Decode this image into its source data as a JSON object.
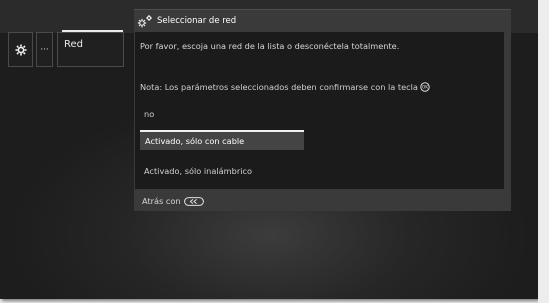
{
  "side_menu": {
    "gear_icon": "gear-icon",
    "more_label": "···",
    "red_label": "Red"
  },
  "dialog": {
    "title_icon": "network-settings-icon",
    "title": "Seleccionar de red",
    "instruction": "Por favor, escoja una red de la lista o desconéctela totalmente.",
    "note": "Nota: Los parámetros seleccionados deben confirmarse con la tecla",
    "note_button_icon": "ok-button-icon",
    "options": [
      {
        "label": "no",
        "selected": false
      },
      {
        "label": "Activado, sólo con cable",
        "selected": true
      },
      {
        "label": "Activado, sólo inalámbrico",
        "selected": false
      }
    ],
    "back_label": "Atrás con",
    "back_button_icon": "back-button-icon"
  },
  "colors": {
    "background": "#1d1d1d",
    "dialog": "#3a3a3a",
    "dialog_body": "#1b1b1b",
    "highlight": "#444444",
    "text": "#d6d6d6"
  }
}
